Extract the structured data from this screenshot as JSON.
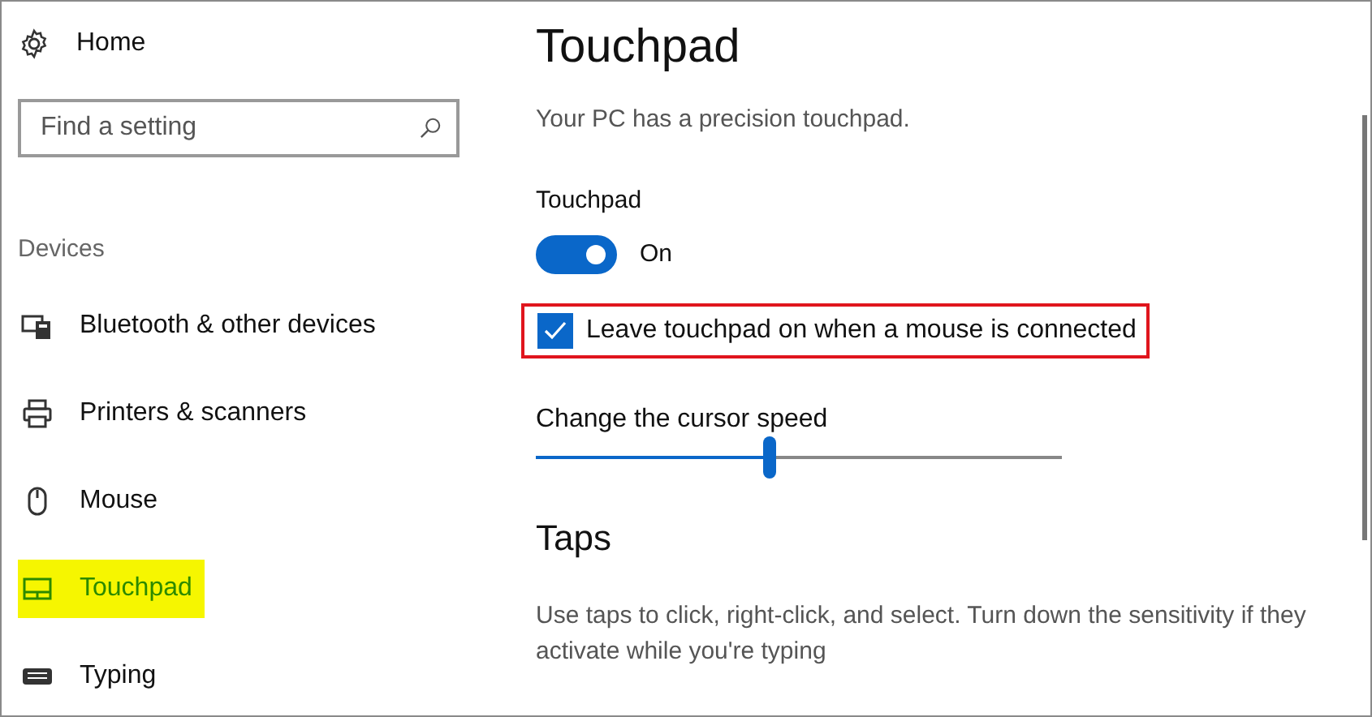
{
  "sidebar": {
    "home": "Home",
    "search": {
      "placeholder": "Find a setting"
    },
    "section": "Devices",
    "items": [
      {
        "label": "Bluetooth & other devices",
        "selected": false
      },
      {
        "label": "Printers & scanners",
        "selected": false
      },
      {
        "label": "Mouse",
        "selected": false
      },
      {
        "label": "Touchpad",
        "selected": true
      },
      {
        "label": "Typing",
        "selected": false
      }
    ]
  },
  "main": {
    "title": "Touchpad",
    "subtitle": "Your PC has a precision touchpad.",
    "toggle": {
      "label": "Touchpad",
      "on": true,
      "state_text": "On"
    },
    "checkbox": {
      "label": "Leave touchpad on when a mouse is connected",
      "checked": true,
      "highlighted": true
    },
    "slider": {
      "label": "Change the cursor speed",
      "level": 0.445
    },
    "section": "Taps",
    "description": "Use taps to click, right-click, and select. Turn down the sensitivity if they activate while you're typing"
  }
}
